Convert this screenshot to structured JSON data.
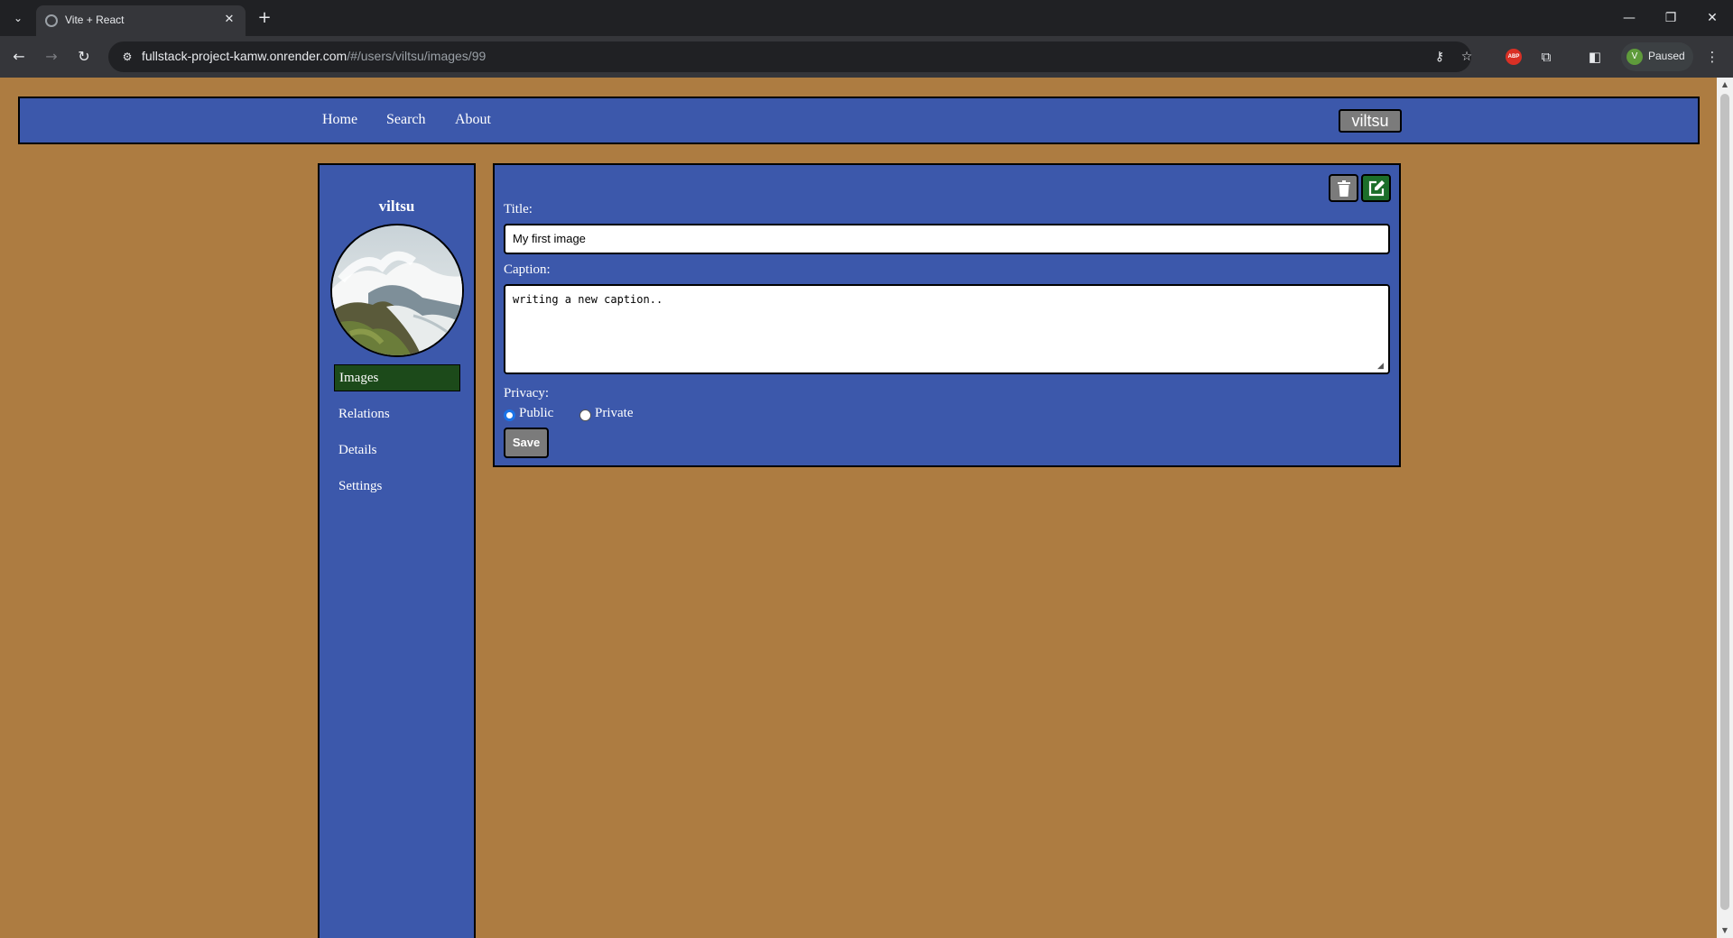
{
  "browser": {
    "tab_title": "Vite + React",
    "tab_list_icon": "chevron-down-icon",
    "url_host": "fullstack-project-kamw.onrender.com",
    "url_path": "/#/users/viltsu/images/99",
    "profile_initial": "V",
    "profile_status": "Paused",
    "extension_abp": "ABP"
  },
  "nav": {
    "links": [
      "Home",
      "Search",
      "About"
    ],
    "user": "viltsu"
  },
  "sidebar": {
    "username": "viltsu",
    "items": [
      {
        "label": "Images",
        "active": true
      },
      {
        "label": "Relations",
        "active": false
      },
      {
        "label": "Details",
        "active": false
      },
      {
        "label": "Settings",
        "active": false
      }
    ]
  },
  "form": {
    "title_label": "Title:",
    "title_value": "My first image",
    "caption_label": "Caption:",
    "caption_value": "writing a new caption..",
    "privacy_label": "Privacy:",
    "privacy_options": [
      "Public",
      "Private"
    ],
    "privacy_selected": "Public",
    "save_label": "Save"
  },
  "colors": {
    "page_bg": "#ad7c41",
    "panel_bg": "#3c58ab",
    "active_item_bg": "#1c4a1a",
    "edit_button_bg": "#1c6e2a",
    "neutral_button_bg": "#7b7b7b"
  }
}
